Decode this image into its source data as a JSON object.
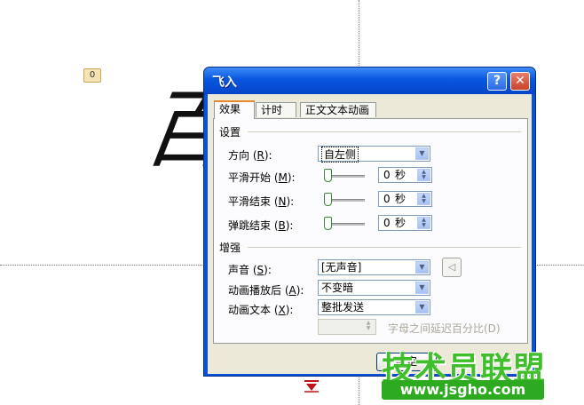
{
  "slide": {
    "animation_tag": "0",
    "calligraphy_char": "百"
  },
  "dialog": {
    "title": "飞入",
    "help_button": "?",
    "close_button": "✕",
    "tabs": [
      {
        "label": "效果",
        "active": true
      },
      {
        "label": "计时",
        "active": false
      },
      {
        "label": "正文文本动画",
        "active": false
      }
    ],
    "settings_group": "设置",
    "direction": {
      "label": "方向",
      "key": "R",
      "value": "自左侧"
    },
    "smooth_start": {
      "label": "平滑开始",
      "key": "M",
      "value": "0",
      "unit": "秒"
    },
    "smooth_end": {
      "label": "平滑结束",
      "key": "N",
      "value": "0",
      "unit": "秒"
    },
    "bounce_end": {
      "label": "弹跳结束",
      "key": "B",
      "value": "0",
      "unit": "秒"
    },
    "enhance_group": "增强",
    "sound": {
      "label": "声音",
      "key": "S",
      "value": "[无声音]"
    },
    "after_animation": {
      "label": "动画播放后",
      "key": "A",
      "value": "不变暗"
    },
    "animate_text": {
      "label": "动画文本",
      "key": "X",
      "value": "整批发送"
    },
    "letter_delay_label": "字母之间延迟百分比(D)",
    "ok_button": "确定"
  },
  "watermark": {
    "main": "技术员联盟",
    "url": "www.jsgho.com"
  },
  "colors": {
    "title_bar": "#0a52d6",
    "dialog_face": "#ece9d8",
    "tab_highlight": "#e68b2c",
    "watermark_green": "#3fbf2a"
  }
}
